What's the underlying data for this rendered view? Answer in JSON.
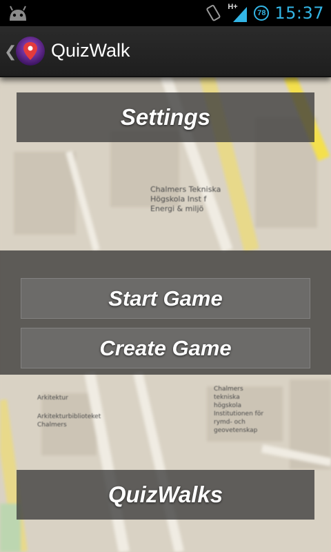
{
  "status_bar": {
    "time": "15:37",
    "network": "H+",
    "battery_level": "78",
    "icons": [
      "android-icon",
      "rotation-icon",
      "signal-icon",
      "battery-icon"
    ]
  },
  "action_bar": {
    "title": "QuizWalk",
    "icons": [
      "back-chevron-icon",
      "map-pin-icon"
    ]
  },
  "buttons": {
    "settings": "Settings",
    "start_game": "Start Game",
    "create_game": "Create Game",
    "quizwalks": "QuizWalks"
  },
  "map_labels": {
    "chalmers_energi": "Chalmers Tekniska Högskola Inst f Energi & miljö",
    "chalmers_rymd": "Chalmers tekniska högskola Institutionen för rymd- och geovetenskap",
    "arkitektur": "Arkitektur",
    "arkitekturbiblioteket": "Arkitekturbiblioteket Chalmers"
  },
  "colors": {
    "accent": "#33b5e5",
    "action_bar": "#252525",
    "map_bg": "#d9d2c4",
    "map_road_yellow": "#f4e04d"
  }
}
